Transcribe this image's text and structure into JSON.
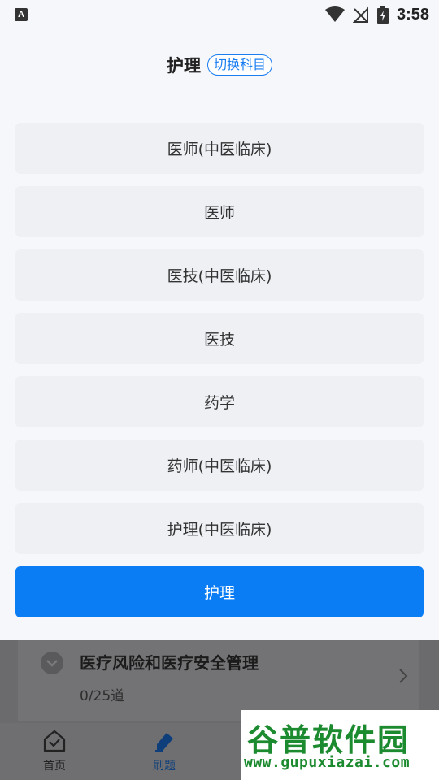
{
  "status_bar": {
    "time": "3:58",
    "notification_icon": "A"
  },
  "header": {
    "title": "护理",
    "switch_label": "切换科目"
  },
  "options": [
    {
      "label": "医师(中医临床)",
      "selected": false
    },
    {
      "label": "医师",
      "selected": false
    },
    {
      "label": "医技(中医临床)",
      "selected": false
    },
    {
      "label": "医技",
      "selected": false
    },
    {
      "label": "药学",
      "selected": false
    },
    {
      "label": "药师(中医临床)",
      "selected": false
    },
    {
      "label": "护理(中医临床)",
      "selected": false
    },
    {
      "label": "护理",
      "selected": true
    }
  ],
  "background_card": {
    "title": "医疗风险和医疗安全管理",
    "progress": "0/25道"
  },
  "tabbar": {
    "tabs": [
      {
        "label": "首页"
      },
      {
        "label": "刷题"
      }
    ]
  },
  "watermark": {
    "text": "谷普软件园",
    "url": "www.gupuxiazai.com"
  },
  "colors": {
    "accent": "#0a7df5",
    "option_bg": "#eef0f4",
    "overlay": "#6b6b6d"
  },
  "icons": {
    "wifi": "wifi-icon",
    "signal": "no-signal-icon",
    "battery": "battery-charging-icon",
    "home": "home-check-icon",
    "practice": "pencil-icon",
    "chevron": "chevron-right-icon"
  }
}
